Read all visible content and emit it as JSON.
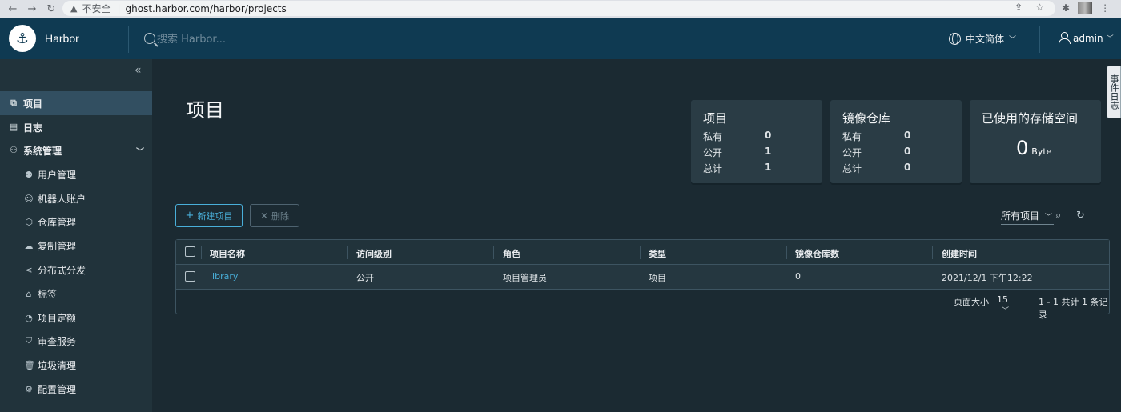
{
  "browser": {
    "insecure_label": "不安全",
    "url": "ghost.harbor.com/harbor/projects"
  },
  "header": {
    "brand": "Harbor",
    "search_placeholder": "搜索 Harbor...",
    "language": "中文简体",
    "user": "admin"
  },
  "sidebar": {
    "items": [
      {
        "label": "项目",
        "icon": "project-icon",
        "active": true
      },
      {
        "label": "日志",
        "icon": "log-icon"
      },
      {
        "label": "系统管理",
        "icon": "admin-icon"
      }
    ],
    "sub_items": [
      {
        "label": "用户管理",
        "icon": "users-icon"
      },
      {
        "label": "机器人账户",
        "icon": "robot-icon"
      },
      {
        "label": "仓库管理",
        "icon": "registry-icon"
      },
      {
        "label": "复制管理",
        "icon": "replication-icon"
      },
      {
        "label": "分布式分发",
        "icon": "distribution-icon"
      },
      {
        "label": "标签",
        "icon": "tag-icon"
      },
      {
        "label": "项目定额",
        "icon": "quota-icon"
      },
      {
        "label": "审查服务",
        "icon": "shield-icon"
      },
      {
        "label": "垃圾清理",
        "icon": "trash-icon"
      },
      {
        "label": "配置管理",
        "icon": "gear-icon"
      }
    ]
  },
  "main": {
    "title": "项目",
    "cards": {
      "projects": {
        "title": "项目",
        "rows": [
          {
            "k": "私有",
            "v": "0"
          },
          {
            "k": "公开",
            "v": "1"
          },
          {
            "k": "总计",
            "v": "1"
          }
        ]
      },
      "repos": {
        "title": "镜像仓库",
        "rows": [
          {
            "k": "私有",
            "v": "0"
          },
          {
            "k": "公开",
            "v": "0"
          },
          {
            "k": "总计",
            "v": "0"
          }
        ]
      },
      "storage": {
        "title": "已使用的存储空间",
        "value": "0",
        "unit": "Byte"
      }
    },
    "new_project_label": "新建项目",
    "delete_label": "删除",
    "filter_label": "所有项目",
    "table": {
      "headers": [
        "项目名称",
        "访问级别",
        "角色",
        "类型",
        "镜像仓库数",
        "创建时间"
      ],
      "rows": [
        [
          "library",
          "公开",
          "项目管理员",
          "项目",
          "0",
          "2021/12/1 下午12:22"
        ]
      ],
      "page_size_label": "页面大小",
      "page_size": "15",
      "summary": "1 - 1 共计 1 条记录"
    }
  },
  "side_tab": "事件日志"
}
